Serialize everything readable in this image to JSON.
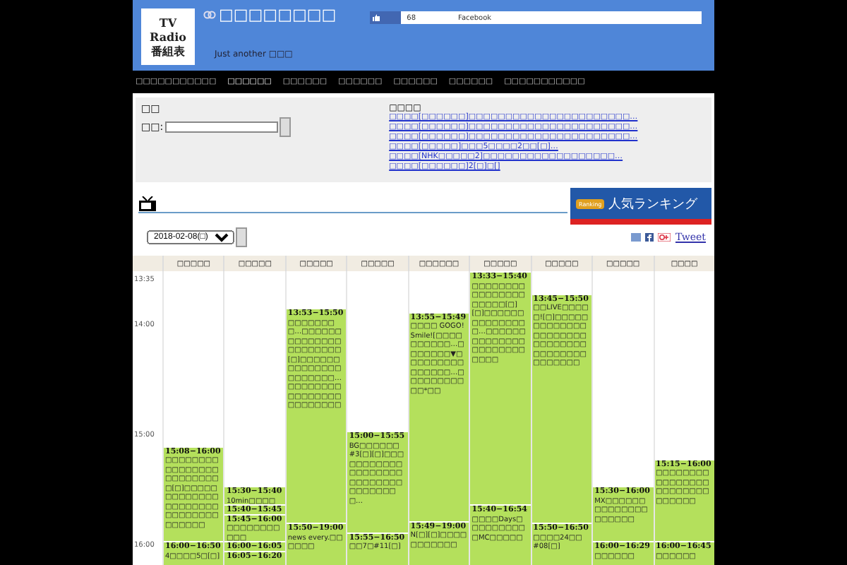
{
  "header": {
    "logo": [
      "TV",
      "Radio",
      "番組表"
    ],
    "site_title": "□□□□□□□□",
    "tagline": "Just another □□□",
    "like_count": "68",
    "like_label": "Facebook"
  },
  "nav": [
    {
      "label": "□□□□□□□□□□□",
      "selected": false
    },
    {
      "label": "□□□□□□",
      "selected": true
    },
    {
      "label": "□□□□□□",
      "selected": false
    },
    {
      "label": "□□□□□□",
      "selected": false
    },
    {
      "label": "□□□□□□",
      "selected": false
    },
    {
      "label": "□□□□□□",
      "selected": false
    },
    {
      "label": "□□□□□□□□□□□",
      "selected": false
    }
  ],
  "search": {
    "heading": "□□",
    "label": "□□:"
  },
  "news": {
    "heading": "□□□□",
    "links": [
      "□□□□[□□□□□□]□□□□□□□□□□□□□□□□□□□□□□…",
      "□□□□[□□□□□□]□□□□□□□□□□□□□□□□□□□□□□…",
      "□□□□[□□□□□□]□□□□□□□□□□□□□□□□□□□□□□…",
      "□□□□[□□□□□]□□□5□□□□2□□[□]…",
      "□□□□[NHK□□□□□2]□□□□□□□□□□□□□□□□□□…",
      "□□□□[□□□□□□]2[□]□[]"
    ]
  },
  "banner": {
    "title": "人気ランキング",
    "tag": "Ranking"
  },
  "date_select": {
    "value": "2018-02-08(□)"
  },
  "share": {
    "tweet": "Tweet"
  },
  "times": [
    "13:35",
    "14:00",
    "15:00",
    "16:00"
  ],
  "channels": [
    {
      "name": "□□□□□",
      "programs": [
        {
          "time": "15:08−16:00",
          "text": "□□□□□□□□□□□□□□□□□□□□□□□□□[□]□□□□□□□□□□□□□□□□□□□□□□□□□□□□□□□□□□□"
        },
        {
          "time": "16:00−16:50",
          "text": "4□□□□5□[□]"
        }
      ]
    },
    {
      "name": "□□□□□",
      "programs": [
        {
          "time": "15:30−15:40",
          "text": "10min□□□□"
        },
        {
          "time": "15:40−15:45"
        },
        {
          "time": "15:45−16:00",
          "text": "□□□□□□□□□□□"
        },
        {
          "time": "16:00−16:05"
        },
        {
          "time": "16:05−16:20"
        }
      ]
    },
    {
      "name": "□□□□□",
      "programs": [
        {
          "time": "13:53−15:50",
          "text": "□□□□□□□□…□□□□□□□□□□□□□□□□□□□□□□[□]□□□□□□□□□□□□□□□□□□□□□…□□□□□□□□□□□□□□□□□□□□□□□□"
        },
        {
          "time": "15:50−19:00",
          "text": "news every.□□□□□□"
        }
      ]
    },
    {
      "name": "□□□□□",
      "programs": [
        {
          "time": "15:00−15:55",
          "text": "BG□□□□□□ #3[□][□]□□□□□□□□□□□□□□□□□□□□□□□□□□□□□□□□□□□…"
        },
        {
          "time": "15:55−16:50",
          "text": "□□7□#11[□]"
        }
      ]
    },
    {
      "name": "□□□□□□",
      "programs": [
        {
          "time": "13:55−15:49",
          "text": "□□□□ GOGO!Smile![□□□□□□□□□□…□□□□□□□▼□□□□□□□□□□□□□□□…□□□□□□□□□□□*□□"
        },
        {
          "time": "15:49−19:00",
          "text": "N[□][□]□□□□□□□□□□□"
        }
      ]
    },
    {
      "name": "□□□□□",
      "programs": [
        {
          "time": "13:33−15:40",
          "text": "□□□□□□□□□□□□□□□□□□□□□[□][□]□□□□□□□□□□□□□□□…□□□□□□□□□□□□□□□□□□□□□□□□□□"
        },
        {
          "time": "15:40−16:54",
          "text": "□□□□Days□□□□□□□□□□MC□□□□□"
        }
      ]
    },
    {
      "name": "□□□□□",
      "programs": [
        {
          "time": "13:45−15:50",
          "text": "□□LIVE□□□□□![□]□□□□□□□□□□□□□□□□□□□□□□□□□□□□□□□□□□□□□□□□□□□□"
        },
        {
          "time": "15:50−16:50",
          "text": "□□□□24□□ #08[□]"
        }
      ]
    },
    {
      "name": "□□□□□",
      "programs": [
        {
          "time": "15:30−16:00",
          "text": "MX□□□□□□□□□□□□□□□□□□□□"
        },
        {
          "time": "16:00−16:29",
          "text": "□□□□□□"
        }
      ]
    },
    {
      "name": "□□□□",
      "programs": [
        {
          "time": "15:15−16:00",
          "text": "□□□□□□□□□□□□□□□□□□□□□□□□□□□□□□"
        },
        {
          "time": "16:00−16:45",
          "text": "□□□□□□"
        }
      ]
    }
  ]
}
